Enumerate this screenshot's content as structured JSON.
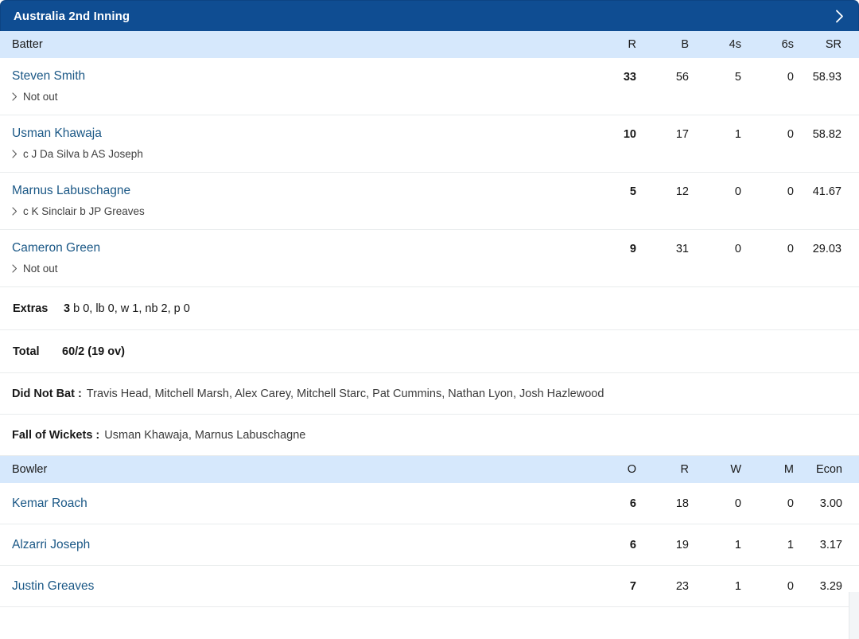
{
  "header": {
    "title": "Australia 2nd Inning",
    "expand_icon": "chevron-right-icon"
  },
  "batting": {
    "columns": {
      "name": "Batter",
      "runs": "R",
      "balls": "B",
      "fours": "4s",
      "sixes": "6s",
      "strike_rate": "SR"
    },
    "rows": [
      {
        "name": "Steven Smith",
        "dismissal": "Not out",
        "R": "33",
        "B": "56",
        "4s": "5",
        "6s": "0",
        "SR": "58.93"
      },
      {
        "name": "Usman Khawaja",
        "dismissal": "c J Da Silva b AS Joseph",
        "R": "10",
        "B": "17",
        "4s": "1",
        "6s": "0",
        "SR": "58.82"
      },
      {
        "name": "Marnus Labuschagne",
        "dismissal": "c K Sinclair b JP Greaves",
        "R": "5",
        "B": "12",
        "4s": "0",
        "6s": "0",
        "SR": "41.67"
      },
      {
        "name": "Cameron Green",
        "dismissal": "Not out",
        "R": "9",
        "B": "31",
        "4s": "0",
        "6s": "0",
        "SR": "29.03"
      }
    ],
    "extras": {
      "label": "Extras",
      "count": "3",
      "breakdown": "b 0, lb 0, w 1, nb 2, p 0"
    },
    "total": {
      "label": "Total",
      "value": "60/2 (19 ov)"
    },
    "did_not_bat": {
      "label": "Did Not Bat :",
      "players": "Travis Head, Mitchell Marsh, Alex Carey, Mitchell Starc, Pat Cummins, Nathan Lyon, Josh Hazlewood"
    },
    "fall_of_wickets": {
      "label": "Fall of Wickets :",
      "players": "Usman Khawaja, Marnus Labuschagne"
    }
  },
  "bowling": {
    "columns": {
      "name": "Bowler",
      "overs": "O",
      "runs": "R",
      "wickets": "W",
      "maidens": "M",
      "economy": "Econ"
    },
    "rows": [
      {
        "name": "Kemar Roach",
        "O": "6",
        "R": "18",
        "W": "0",
        "M": "0",
        "Econ": "3.00"
      },
      {
        "name": "Alzarri Joseph",
        "O": "6",
        "R": "19",
        "W": "1",
        "M": "1",
        "Econ": "3.17"
      },
      {
        "name": "Justin Greaves",
        "O": "7",
        "R": "23",
        "W": "1",
        "M": "0",
        "Econ": "3.29"
      }
    ]
  },
  "colors": {
    "header_blue": "#0f4d92",
    "column_header_blue": "#d6e8fc",
    "link_navy": "#1b5886",
    "divider": "#e9eced"
  }
}
